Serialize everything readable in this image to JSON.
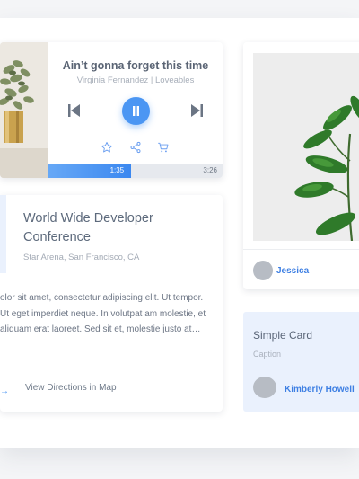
{
  "player": {
    "song_title": "Ain’t gonna forget this time",
    "artist_line": "Virginia Fernandez | Loveables",
    "current_time": "1:35",
    "total_time": "3:26",
    "progress_fraction": 0.475,
    "accent_color": "#4b96f3"
  },
  "event": {
    "title": "World Wide Developer Conference",
    "location": "Star Arena, San Francisco, CA",
    "description": "olor sit amet, consectetur adipiscing elit. Ut tempor. Ut eget imperdiet neque. In volutpat am molestie, et aliquam erat laoreet. Sed sit et, molestie justo at…",
    "directions_label": "View Directions in Map",
    "arrow_glyph": "→"
  },
  "plant_card": {
    "user_name": "Jessica"
  },
  "simple_card": {
    "title": "Simple Card",
    "caption": "Caption",
    "user_name": "Kimberly Howell",
    "background_color": "#eaf1fd"
  }
}
